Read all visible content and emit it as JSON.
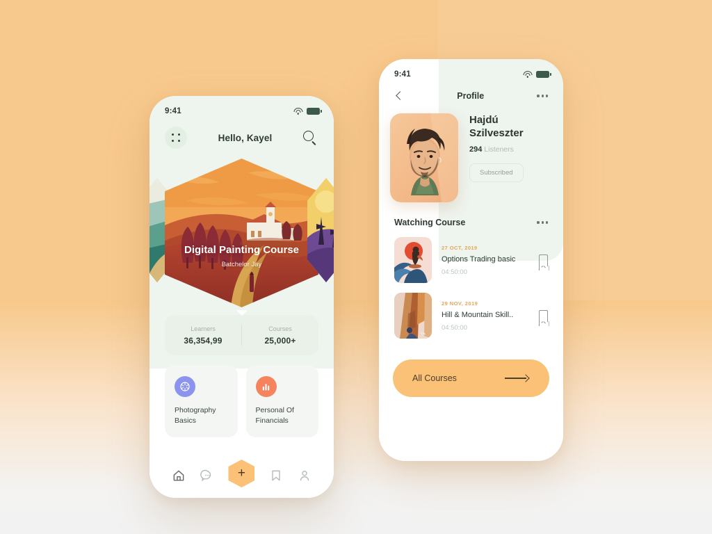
{
  "background": {
    "top_color": "#f8c98a",
    "bottom_color": "#f2f2f2"
  },
  "left_phone": {
    "status_bar": {
      "time": "9:41",
      "wifi": "wifi-icon",
      "battery": "battery-icon"
    },
    "header": {
      "menu": "grid-dots-icon",
      "greeting": "Hello, Kayel",
      "search": "search-icon"
    },
    "hero": {
      "title": "Digital Painting Course",
      "author": "Batchelor Jay",
      "card_style": "hexagon",
      "illustration": "tuscany-hill-village-sunset"
    },
    "stats": [
      {
        "label": "Learners",
        "value": "36,354,99"
      },
      {
        "label": "Courses",
        "value": "25,000+"
      }
    ],
    "categories": [
      {
        "name": "Photography Basics",
        "icon": "camera-aperture-icon",
        "color": "#8b93ee"
      },
      {
        "name": "Personal Of Financials",
        "icon": "bar-chart-icon",
        "color": "#f5845e"
      }
    ],
    "tabbar": {
      "items": [
        {
          "icon": "home-icon",
          "active": true
        },
        {
          "icon": "chat-icon",
          "active": false
        },
        {
          "icon": "plus-icon",
          "active": false,
          "accent": "#fbc177"
        },
        {
          "icon": "bookmark-icon",
          "active": false
        },
        {
          "icon": "profile-icon",
          "active": false
        }
      ]
    }
  },
  "right_phone": {
    "status_bar": {
      "time": "9:41",
      "wifi": "wifi-icon",
      "battery": "battery-icon"
    },
    "header": {
      "back": "chevron-left-icon",
      "title": "Profile",
      "more": "more-horizontal-icon"
    },
    "profile": {
      "avatar": "portrait-man-curly-hair-green-shirt",
      "name": "Hajdú Szilveszter",
      "listeners_count": "294",
      "listeners_label": "Listeners",
      "subscribe_label": "Subscribed"
    },
    "watching": {
      "section_title": "Watching Course",
      "more": "more-horizontal-icon",
      "courses": [
        {
          "date": "27 OCT, 2019",
          "title": "Options Trading basic",
          "duration": "04:50:00",
          "thumb": "surfer-on-wave-red-sun",
          "bookmark": "bookmark-icon"
        },
        {
          "date": "29 NOV, 2019",
          "title": "Hill & Mountain Skill..",
          "duration": "04:50:00",
          "thumb": "canyon-desert-rocks",
          "bookmark": "bookmark-icon"
        }
      ]
    },
    "all_courses": {
      "label": "All Courses",
      "arrow": "arrow-right-icon",
      "color": "#fbc177"
    }
  }
}
